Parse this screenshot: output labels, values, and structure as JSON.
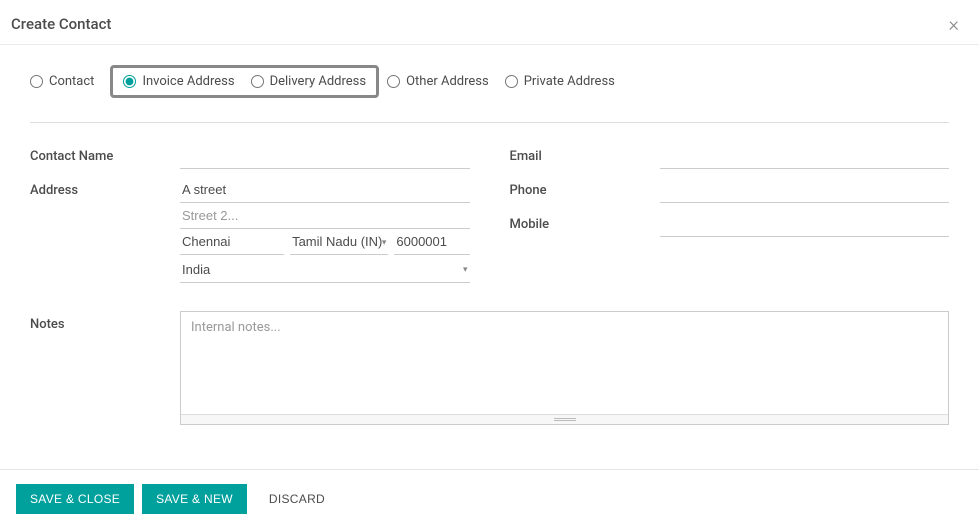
{
  "header": {
    "title": "Create Contact"
  },
  "type": {
    "options": {
      "contact": "Contact",
      "invoice": "Invoice Address",
      "delivery": "Delivery Address",
      "other": "Other Address",
      "private": "Private Address"
    },
    "selected": "invoice"
  },
  "fields": {
    "contact_name_label": "Contact Name",
    "contact_name_value": "",
    "address_label": "Address",
    "street1_value": "A street",
    "street2_value": "",
    "street2_placeholder": "Street 2...",
    "city_value": "Chennai",
    "state_value": "Tamil Nadu (IN)",
    "zip_value": "6000001",
    "country_value": "India",
    "email_label": "Email",
    "email_value": "",
    "phone_label": "Phone",
    "phone_value": "",
    "mobile_label": "Mobile",
    "mobile_value": ""
  },
  "notes": {
    "label": "Notes",
    "placeholder": "Internal notes...",
    "value": ""
  },
  "footer": {
    "save_close": "SAVE & CLOSE",
    "save_new": "SAVE & NEW",
    "discard": "DISCARD"
  }
}
